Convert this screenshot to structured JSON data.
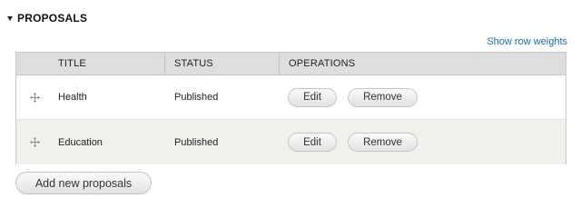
{
  "section": {
    "title": "PROPOSALS",
    "toggle_icon": "caret-down-icon"
  },
  "row_weights_link": "Show row weights",
  "table": {
    "columns": [
      "TITLE",
      "STATUS",
      "OPERATIONS"
    ],
    "rows": [
      {
        "drag_icon": "drag-handle-icon",
        "title": "Health",
        "status": "Published",
        "edit_label": "Edit",
        "remove_label": "Remove"
      },
      {
        "drag_icon": "drag-handle-icon",
        "title": "Education",
        "status": "Published",
        "edit_label": "Edit",
        "remove_label": "Remove"
      }
    ]
  },
  "add_button": "Add new proposals",
  "colors": {
    "link": "#1a6aa7",
    "header_bg": "#dedede",
    "even_row_bg": "#f0f0ed"
  }
}
